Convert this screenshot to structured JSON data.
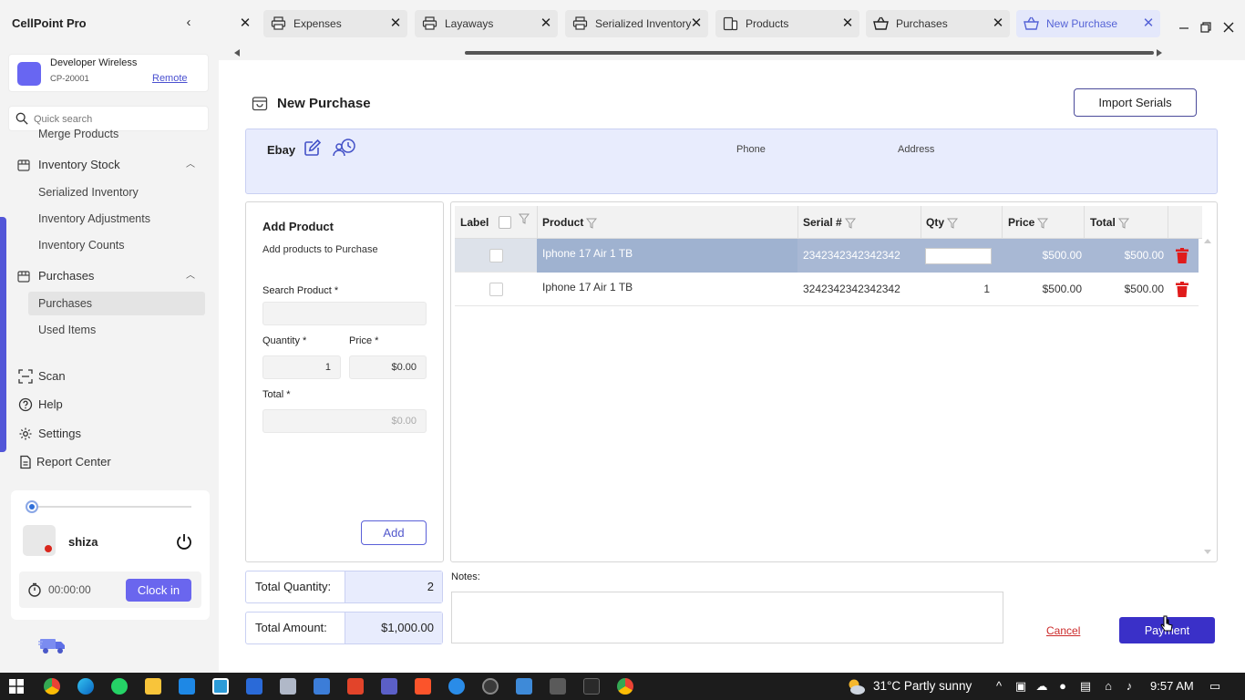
{
  "app": {
    "title": "CellPoint Pro"
  },
  "store": {
    "name": "Developer Wireless",
    "id": "CP-20001",
    "remote_label": "Remote",
    "avatar_color": "#6866f2"
  },
  "search": {
    "placeholder": "Quick search"
  },
  "sidebar": {
    "items": [
      {
        "label": "Merge Products"
      },
      {
        "label": "Inventory Stock",
        "icon": "box-icon",
        "expanded": true
      },
      {
        "label": "Serialized Inventory"
      },
      {
        "label": "Inventory Adjustments"
      },
      {
        "label": "Inventory Counts"
      },
      {
        "label": "Purchases",
        "icon": "box-icon",
        "expanded": true
      },
      {
        "label": "Purchases",
        "active": true
      },
      {
        "label": "Used Items"
      },
      {
        "label": "Scan",
        "icon": "scan-icon"
      },
      {
        "label": "Help",
        "icon": "help-icon"
      },
      {
        "label": "Settings",
        "icon": "gear-icon"
      },
      {
        "label": "Report Center",
        "icon": "report-icon"
      }
    ]
  },
  "user": {
    "name": "shiza",
    "timer": "00:00:00",
    "clock_in_label": "Clock in",
    "status_color": "#d9261c"
  },
  "tabs": [
    {
      "label": "Expenses",
      "icon": "printer-icon"
    },
    {
      "label": "Layaways",
      "icon": "printer-icon"
    },
    {
      "label": "Serialized Inventory",
      "icon": "printer-icon"
    },
    {
      "label": "Products",
      "icon": "devices-icon"
    },
    {
      "label": "Purchases",
      "icon": "basket-icon"
    },
    {
      "label": "New Purchase",
      "icon": "basket-icon",
      "active": true
    }
  ],
  "page": {
    "title": "New Purchase",
    "import_label": "Import Serials"
  },
  "vendor": {
    "name": "Ebay",
    "phone_label": "Phone",
    "address_label": "Address"
  },
  "add_product": {
    "title": "Add Product",
    "subtitle": "Add products to Purchase",
    "search_label": "Search Product *",
    "search_value": "",
    "quantity_label": "Quantity *",
    "quantity_value": "1",
    "price_label": "Price *",
    "price_value": "$0.00",
    "total_label": "Total *",
    "total_value": "$0.00",
    "add_label": "Add"
  },
  "grid": {
    "columns": [
      "Label",
      "Product",
      "Serial #",
      "Qty",
      "Price",
      "Total"
    ],
    "rows": [
      {
        "product": "Iphone 17 Air 1 TB",
        "serial": "2342342342342342",
        "qty": "",
        "price": "$500.00",
        "total": "$500.00",
        "selected": true
      },
      {
        "product": "Iphone 17 Air 1 TB",
        "serial": "3242342342342342",
        "qty": "1",
        "price": "$500.00",
        "total": "$500.00",
        "selected": false
      }
    ]
  },
  "totals": {
    "quantity_label": "Total Quantity:",
    "quantity_value": "2",
    "amount_label": "Total Amount:",
    "amount_value": "$1,000.00"
  },
  "notes": {
    "label": "Notes:",
    "value": ""
  },
  "actions": {
    "cancel_label": "Cancel",
    "payment_label": "Payment"
  },
  "colors": {
    "accent": "#6a66ee",
    "primary_button": "#3a30c8",
    "delete": "#e01b1b",
    "vendor_panel": "#e8ecfd"
  },
  "taskbar": {
    "weather": "31°C  Partly sunny",
    "time": "9:57 AM"
  }
}
